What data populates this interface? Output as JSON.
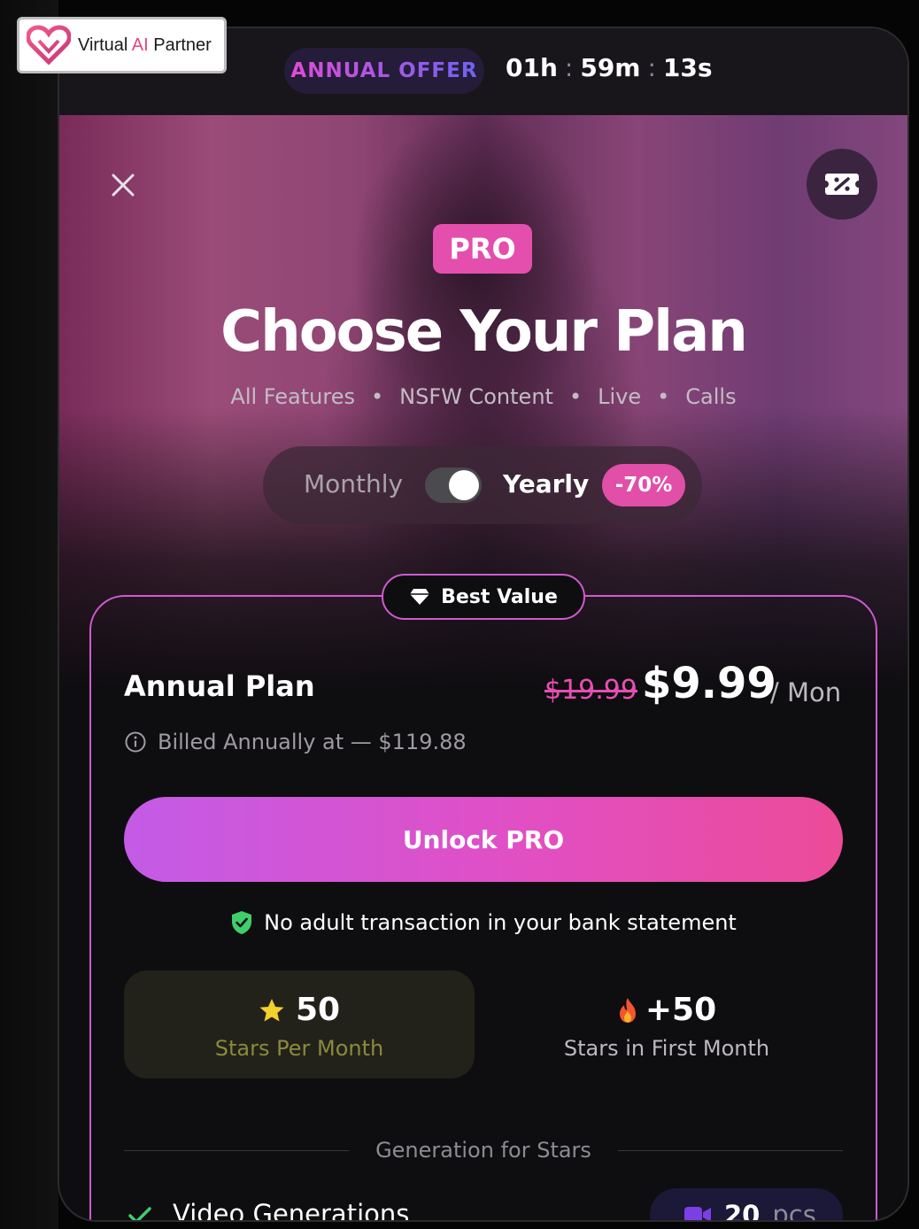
{
  "brand": {
    "name_prefix": "Virtual ",
    "name_ai": "AI",
    "name_suffix": " Partner"
  },
  "offer": {
    "label": "ANNUAL OFFER",
    "timer": {
      "hours": "01h",
      "minutes": "59m",
      "seconds": "13s",
      "separator": ":"
    }
  },
  "hero": {
    "badge": "PRO",
    "title": "Choose Your Plan",
    "features": [
      "All Features",
      "NSFW Content",
      "Live",
      "Calls"
    ],
    "feature_separator": "•"
  },
  "billing_toggle": {
    "monthly_label": "Monthly",
    "yearly_label": "Yearly",
    "selected": "Yearly",
    "discount_badge": "-70%"
  },
  "plan": {
    "ribbon": "Best Value",
    "name": "Annual Plan",
    "old_price": "$19.99",
    "price": "$9.99",
    "period": "/ Mon",
    "billed_note": "Billed Annually at — $119.88",
    "cta_label": "Unlock PRO",
    "secure_note": "No adult transaction in your bank statement"
  },
  "stars": {
    "monthly": {
      "value": "50",
      "label": "Stars Per Month"
    },
    "bonus": {
      "value": "+50",
      "label": "Stars in First Month"
    }
  },
  "generation": {
    "section_title": "Generation for Stars",
    "items": [
      {
        "label": "Video Generations",
        "count": "20",
        "unit": "pcs"
      }
    ]
  },
  "colors": {
    "accent_pink": "#e44fad",
    "accent_purple": "#c35be6",
    "card_border": "#d05ad0",
    "check_green": "#3ecf6a"
  },
  "icons": [
    "close-icon",
    "coupon-icon",
    "diamond-icon",
    "info-icon",
    "shield-check-icon",
    "star-icon",
    "fire-icon",
    "check-icon",
    "video-camera-icon",
    "heart-logo-icon"
  ]
}
